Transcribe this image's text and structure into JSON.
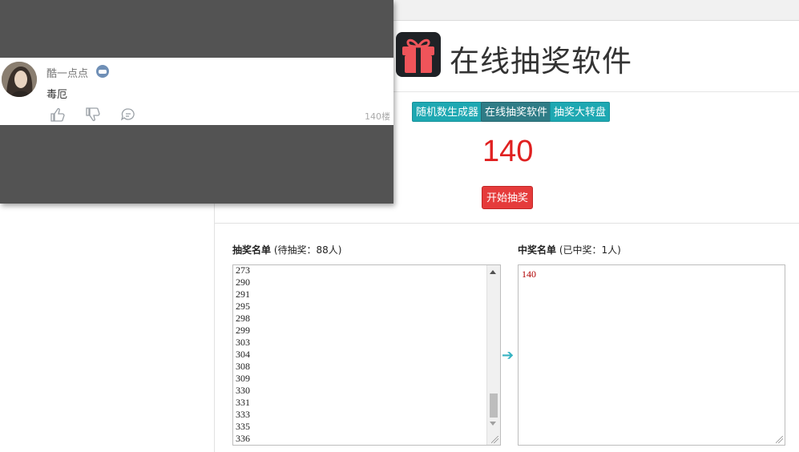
{
  "app": {
    "title": "在线抽奖软件",
    "nav": [
      "随机数生成器",
      "在线抽奖软件",
      "抽奖大转盘"
    ],
    "current_number": "140",
    "start_button": "开始抽奖"
  },
  "pool": {
    "label_bold": "抽奖名单",
    "label_rest": "(待抽奖：88人)",
    "numbers": [
      "273",
      "290",
      "291",
      "295",
      "298",
      "299",
      "303",
      "304",
      "308",
      "309",
      "330",
      "331",
      "333",
      "335",
      "336"
    ]
  },
  "winners": {
    "label_bold": "中奖名单",
    "label_rest": "(已中奖：1人)",
    "values": [
      "140"
    ]
  },
  "comment_overlay": {
    "username": "酷一点点",
    "text": "毒厄",
    "floor": "140楼"
  },
  "colors": {
    "nav_button": "#1ea8b2",
    "nav_active": "#2f7c86",
    "number": "#e02020",
    "start_button": "#e53b3b",
    "winner_text": "#b00000"
  },
  "icons": [
    "gift-icon",
    "game-controller-icon",
    "thumbs-up-icon",
    "thumbs-down-icon",
    "reply-icon",
    "arrow-right-icon"
  ]
}
